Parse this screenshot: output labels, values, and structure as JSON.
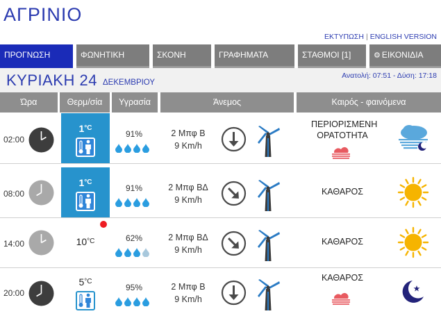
{
  "city": "ΑΓΡΙΝΙΟ",
  "toplinks": {
    "print": "ΕΚΤΥΠΩΣΗ",
    "separator": "|",
    "english": "ENGLISH VERSION"
  },
  "tabs": [
    {
      "label": "ΠΡΟΓΝΩΣΗ",
      "active": true
    },
    {
      "label": "ΦΩΝΗΤΙΚΗ",
      "active": false
    },
    {
      "label": "ΣΚΟΝΗ",
      "active": false
    },
    {
      "label": "ΓΡΑΦΗΜΑΤΑ",
      "active": false
    },
    {
      "label": "ΣΤΑΘΜΟΙ [1]",
      "active": false
    },
    {
      "label": "ΕΙΚΟΝΙΔΙΑ",
      "active": false,
      "icon": "gear-icon"
    }
  ],
  "date": {
    "day": "ΚΥΡΙΑΚΗ 24",
    "month": "ΔΕΚΕΜΒΡΙΟΥ",
    "sun": "Ανατολή: 07:51 - Δύση: 17:18"
  },
  "headers": {
    "time": "Ώρα",
    "temp": "Θερμ/σία",
    "humidity": "Υγρασία",
    "wind": "Άνεμος",
    "weather": "Καιρός - φαινόμενα"
  },
  "temp_unit": "°C",
  "colors": {
    "brand": "#2b3bb0",
    "active_tab": "#1a2bb8",
    "tab": "#7d7d7d",
    "header": "#8e8e8e",
    "cold_cell": "#2793cd",
    "drop": "#2a9de0",
    "sun": "#f6b400",
    "moon": "#23237a",
    "alert": "#ee1d23"
  },
  "rows": [
    {
      "time": "02:00",
      "clock": "dark",
      "hour": 2,
      "temp": "1",
      "cold": true,
      "person_icon": "thermometer-person-cold-icon",
      "humidity": "91%",
      "drops": 4,
      "wind_force": "2 Μπφ Β",
      "wind_speed": "9 Km/h",
      "wind_dir_deg": 180,
      "condition": "ΠΕΡΙΟΡΙΣΜΕΝΗ ΟΡΑΤΟΤΗΤΑ",
      "haze": true,
      "weather_icon": "cloud-fog-night-icon"
    },
    {
      "time": "08:00",
      "clock": "light",
      "hour": 8,
      "temp": "1",
      "cold": true,
      "person_icon": "thermometer-person-cold-icon",
      "humidity": "91%",
      "drops": 4,
      "wind_force": "2 Μπφ ΒΔ",
      "wind_speed": "9 Km/h",
      "wind_dir_deg": 135,
      "condition": "ΚΑΘΑΡΟΣ",
      "haze": false,
      "weather_icon": "sun-icon"
    },
    {
      "time": "14:00",
      "clock": "light",
      "hour": 2,
      "temp": "10",
      "cold": false,
      "alert": true,
      "humidity": "62%",
      "drops": 3,
      "wind_force": "2 Μπφ ΒΔ",
      "wind_speed": "9 Km/h",
      "wind_dir_deg": 135,
      "condition": "ΚΑΘΑΡΟΣ",
      "haze": false,
      "weather_icon": "sun-icon"
    },
    {
      "time": "20:00",
      "clock": "dark",
      "hour": 8,
      "temp": "5",
      "cold": false,
      "person_icon": "thermometer-person-cold-icon",
      "humidity": "95%",
      "drops": 4,
      "wind_force": "2 Μπφ Β",
      "wind_speed": "9 Km/h",
      "wind_dir_deg": 180,
      "condition": "ΚΑΘΑΡΟΣ",
      "haze": true,
      "weather_icon": "moon-star-icon"
    }
  ]
}
